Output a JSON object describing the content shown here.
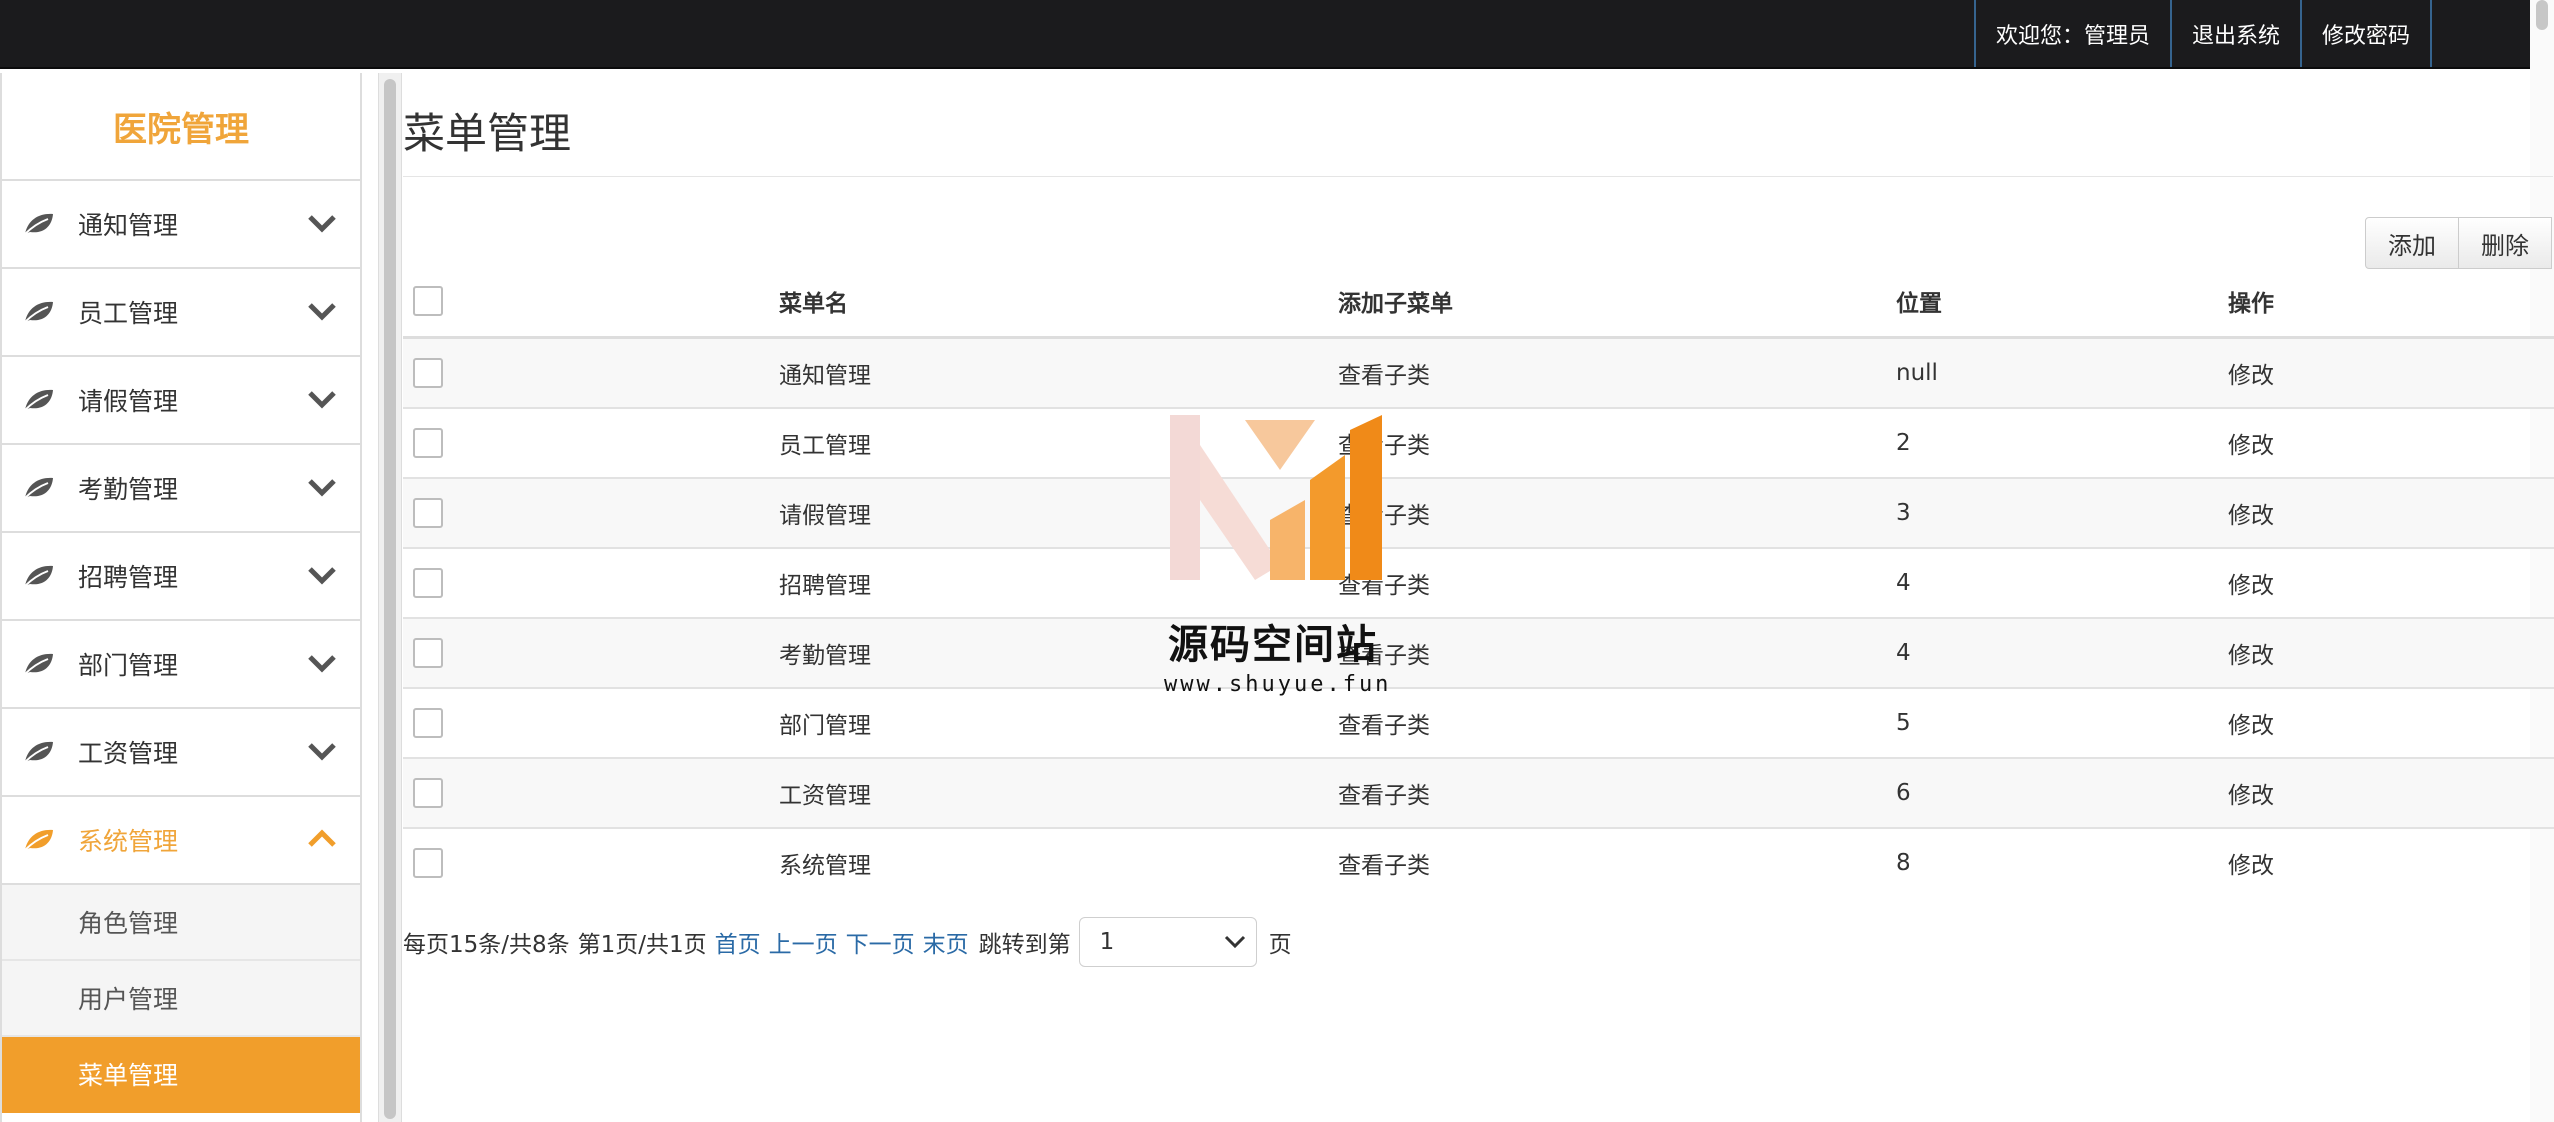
{
  "topbar": {
    "welcome": "欢迎您：管理员",
    "logout": "退出系统",
    "change_password": "修改密码"
  },
  "sidebar": {
    "brand": "医院管理",
    "items": [
      {
        "label": "通知管理",
        "icon": "leaf-icon",
        "expanded": false
      },
      {
        "label": "员工管理",
        "icon": "leaf-icon",
        "expanded": false
      },
      {
        "label": "请假管理",
        "icon": "leaf-icon",
        "expanded": false
      },
      {
        "label": "考勤管理",
        "icon": "leaf-icon",
        "expanded": false
      },
      {
        "label": "招聘管理",
        "icon": "leaf-icon",
        "expanded": false
      },
      {
        "label": "部门管理",
        "icon": "leaf-icon",
        "expanded": false
      },
      {
        "label": "工资管理",
        "icon": "leaf-icon",
        "expanded": false
      },
      {
        "label": "系统管理",
        "icon": "leaf-icon",
        "expanded": true
      }
    ],
    "subitems": [
      {
        "label": "角色管理",
        "active": false
      },
      {
        "label": "用户管理",
        "active": false
      },
      {
        "label": "菜单管理",
        "active": true
      }
    ]
  },
  "main": {
    "title": "菜单管理",
    "add_button": "添加",
    "delete_button": "删除",
    "table": {
      "headers": {
        "name": "菜单名",
        "sub": "添加子菜单",
        "position": "位置",
        "action": "操作"
      },
      "rows": [
        {
          "name": "通知管理",
          "sub": "查看子类",
          "position": "null",
          "action": "修改"
        },
        {
          "name": "员工管理",
          "sub": "查看子类",
          "position": "2",
          "action": "修改"
        },
        {
          "name": "请假管理",
          "sub": "查看子类",
          "position": "3",
          "action": "修改"
        },
        {
          "name": "招聘管理",
          "sub": "查看子类",
          "position": "4",
          "action": "修改"
        },
        {
          "name": "考勤管理",
          "sub": "查看子类",
          "position": "4",
          "action": "修改"
        },
        {
          "name": "部门管理",
          "sub": "查看子类",
          "position": "5",
          "action": "修改"
        },
        {
          "name": "工资管理",
          "sub": "查看子类",
          "position": "6",
          "action": "修改"
        },
        {
          "name": "系统管理",
          "sub": "查看子类",
          "position": "8",
          "action": "修改"
        }
      ]
    },
    "pager": {
      "per_page": "每页15条/共8条",
      "current": "第1页/共1页",
      "first": "首页",
      "prev": "上一页",
      "next": "下一页",
      "last": "末页",
      "jump_label": "跳转到第",
      "page_value": "1",
      "unit": "页"
    }
  },
  "watermark": {
    "text": "源码空间站",
    "url": "www.shuyue.fun"
  },
  "colors": {
    "accent": "#f19e2b",
    "topbar": "#1b1b1d",
    "link": "#2a6aa6"
  }
}
